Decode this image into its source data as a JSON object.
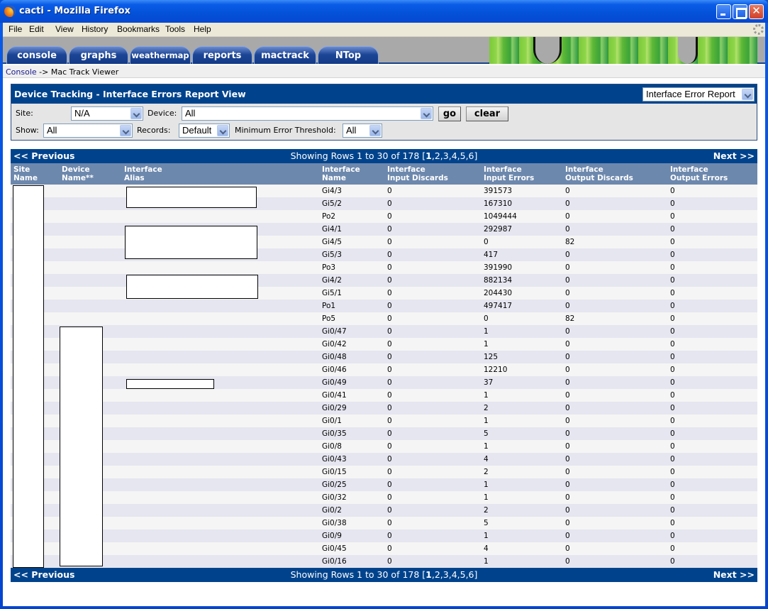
{
  "window": {
    "title": "cacti - Mozilla Firefox",
    "controls": [
      "minimize",
      "maximize",
      "close"
    ]
  },
  "menubar": {
    "items": [
      "File",
      "Edit",
      "View",
      "History",
      "Bookmarks",
      "Tools",
      "Help"
    ]
  },
  "tabs": [
    "console",
    "graphs",
    "weathermap",
    "reports",
    "mactrack",
    "NTop"
  ],
  "breadcrumb": {
    "link": "Console",
    "separator": "->",
    "current": "Mac Track Viewer"
  },
  "filter": {
    "title": "Device Tracking - Interface Errors Report View",
    "report_select": "Interface Error Report",
    "site_label": "Site:",
    "site_value": "N/A",
    "device_label": "Device:",
    "device_value": "All",
    "go_label": "go",
    "clear_label": "clear",
    "show_label": "Show:",
    "show_value": "All",
    "records_label": "Records:",
    "records_value": "Default",
    "threshold_label": "Minimum Error Threshold:",
    "threshold_value": "All"
  },
  "pager": {
    "prev": "<< Previous",
    "showing_prefix": "Showing Rows 1 to 30 of 178 [",
    "current_page": "1",
    "other_pages": ",2,3,4,5,6]",
    "next": "Next >>"
  },
  "columns": [
    [
      "Site",
      "Name"
    ],
    [
      "Device",
      "Name**"
    ],
    [
      "Interface",
      "Alias"
    ],
    [
      "Interface",
      "Name"
    ],
    [
      "Interface",
      "Input Discards"
    ],
    [
      "Interface",
      "Input Errors"
    ],
    [
      "Interface",
      "Output Discards"
    ],
    [
      "Interface",
      "Output Errors"
    ]
  ],
  "rows": [
    {
      "name": "Gi4/3",
      "in_disc": "0",
      "in_err": "391573",
      "out_disc": "0",
      "out_err": "0"
    },
    {
      "name": "Gi5/2",
      "in_disc": "0",
      "in_err": "167310",
      "out_disc": "0",
      "out_err": "0"
    },
    {
      "name": "Po2",
      "in_disc": "0",
      "in_err": "1049444",
      "out_disc": "0",
      "out_err": "0"
    },
    {
      "name": "Gi4/1",
      "in_disc": "0",
      "in_err": "292987",
      "out_disc": "0",
      "out_err": "0"
    },
    {
      "name": "Gi4/5",
      "in_disc": "0",
      "in_err": "0",
      "out_disc": "82",
      "out_err": "0"
    },
    {
      "name": "Gi5/3",
      "in_disc": "0",
      "in_err": "417",
      "out_disc": "0",
      "out_err": "0"
    },
    {
      "name": "Po3",
      "in_disc": "0",
      "in_err": "391990",
      "out_disc": "0",
      "out_err": "0"
    },
    {
      "name": "Gi4/2",
      "in_disc": "0",
      "in_err": "882134",
      "out_disc": "0",
      "out_err": "0"
    },
    {
      "name": "Gi5/1",
      "in_disc": "0",
      "in_err": "204430",
      "out_disc": "0",
      "out_err": "0"
    },
    {
      "name": "Po1",
      "in_disc": "0",
      "in_err": "497417",
      "out_disc": "0",
      "out_err": "0"
    },
    {
      "name": "Po5",
      "in_disc": "0",
      "in_err": "0",
      "out_disc": "82",
      "out_err": "0"
    },
    {
      "name": "Gi0/47",
      "in_disc": "0",
      "in_err": "1",
      "out_disc": "0",
      "out_err": "0"
    },
    {
      "name": "Gi0/42",
      "in_disc": "0",
      "in_err": "1",
      "out_disc": "0",
      "out_err": "0"
    },
    {
      "name": "Gi0/48",
      "in_disc": "0",
      "in_err": "125",
      "out_disc": "0",
      "out_err": "0"
    },
    {
      "name": "Gi0/46",
      "in_disc": "0",
      "in_err": "12210",
      "out_disc": "0",
      "out_err": "0"
    },
    {
      "name": "Gi0/49",
      "in_disc": "0",
      "in_err": "37",
      "out_disc": "0",
      "out_err": "0"
    },
    {
      "name": "Gi0/41",
      "in_disc": "0",
      "in_err": "1",
      "out_disc": "0",
      "out_err": "0"
    },
    {
      "name": "Gi0/29",
      "in_disc": "0",
      "in_err": "2",
      "out_disc": "0",
      "out_err": "0"
    },
    {
      "name": "Gi0/1",
      "in_disc": "0",
      "in_err": "1",
      "out_disc": "0",
      "out_err": "0"
    },
    {
      "name": "Gi0/35",
      "in_disc": "0",
      "in_err": "5",
      "out_disc": "0",
      "out_err": "0"
    },
    {
      "name": "Gi0/8",
      "in_disc": "0",
      "in_err": "1",
      "out_disc": "0",
      "out_err": "0"
    },
    {
      "name": "Gi0/43",
      "in_disc": "0",
      "in_err": "4",
      "out_disc": "0",
      "out_err": "0"
    },
    {
      "name": "Gi0/15",
      "in_disc": "0",
      "in_err": "2",
      "out_disc": "0",
      "out_err": "0"
    },
    {
      "name": "Gi0/25",
      "in_disc": "0",
      "in_err": "1",
      "out_disc": "0",
      "out_err": "0"
    },
    {
      "name": "Gi0/32",
      "in_disc": "0",
      "in_err": "1",
      "out_disc": "0",
      "out_err": "0"
    },
    {
      "name": "Gi0/2",
      "in_disc": "0",
      "in_err": "2",
      "out_disc": "0",
      "out_err": "0"
    },
    {
      "name": "Gi0/38",
      "in_disc": "0",
      "in_err": "5",
      "out_disc": "0",
      "out_err": "0"
    },
    {
      "name": "Gi0/9",
      "in_disc": "0",
      "in_err": "1",
      "out_disc": "0",
      "out_err": "0"
    },
    {
      "name": "Gi0/45",
      "in_disc": "0",
      "in_err": "4",
      "out_disc": "0",
      "out_err": "0"
    },
    {
      "name": "Gi0/16",
      "in_disc": "0",
      "in_err": "1",
      "out_disc": "0",
      "out_err": "0"
    }
  ],
  "colors": {
    "header_blue": "#00438c",
    "column_header": "#6d88ad",
    "row_odd": "#f5f5f5",
    "row_even": "#e5e6f0"
  }
}
